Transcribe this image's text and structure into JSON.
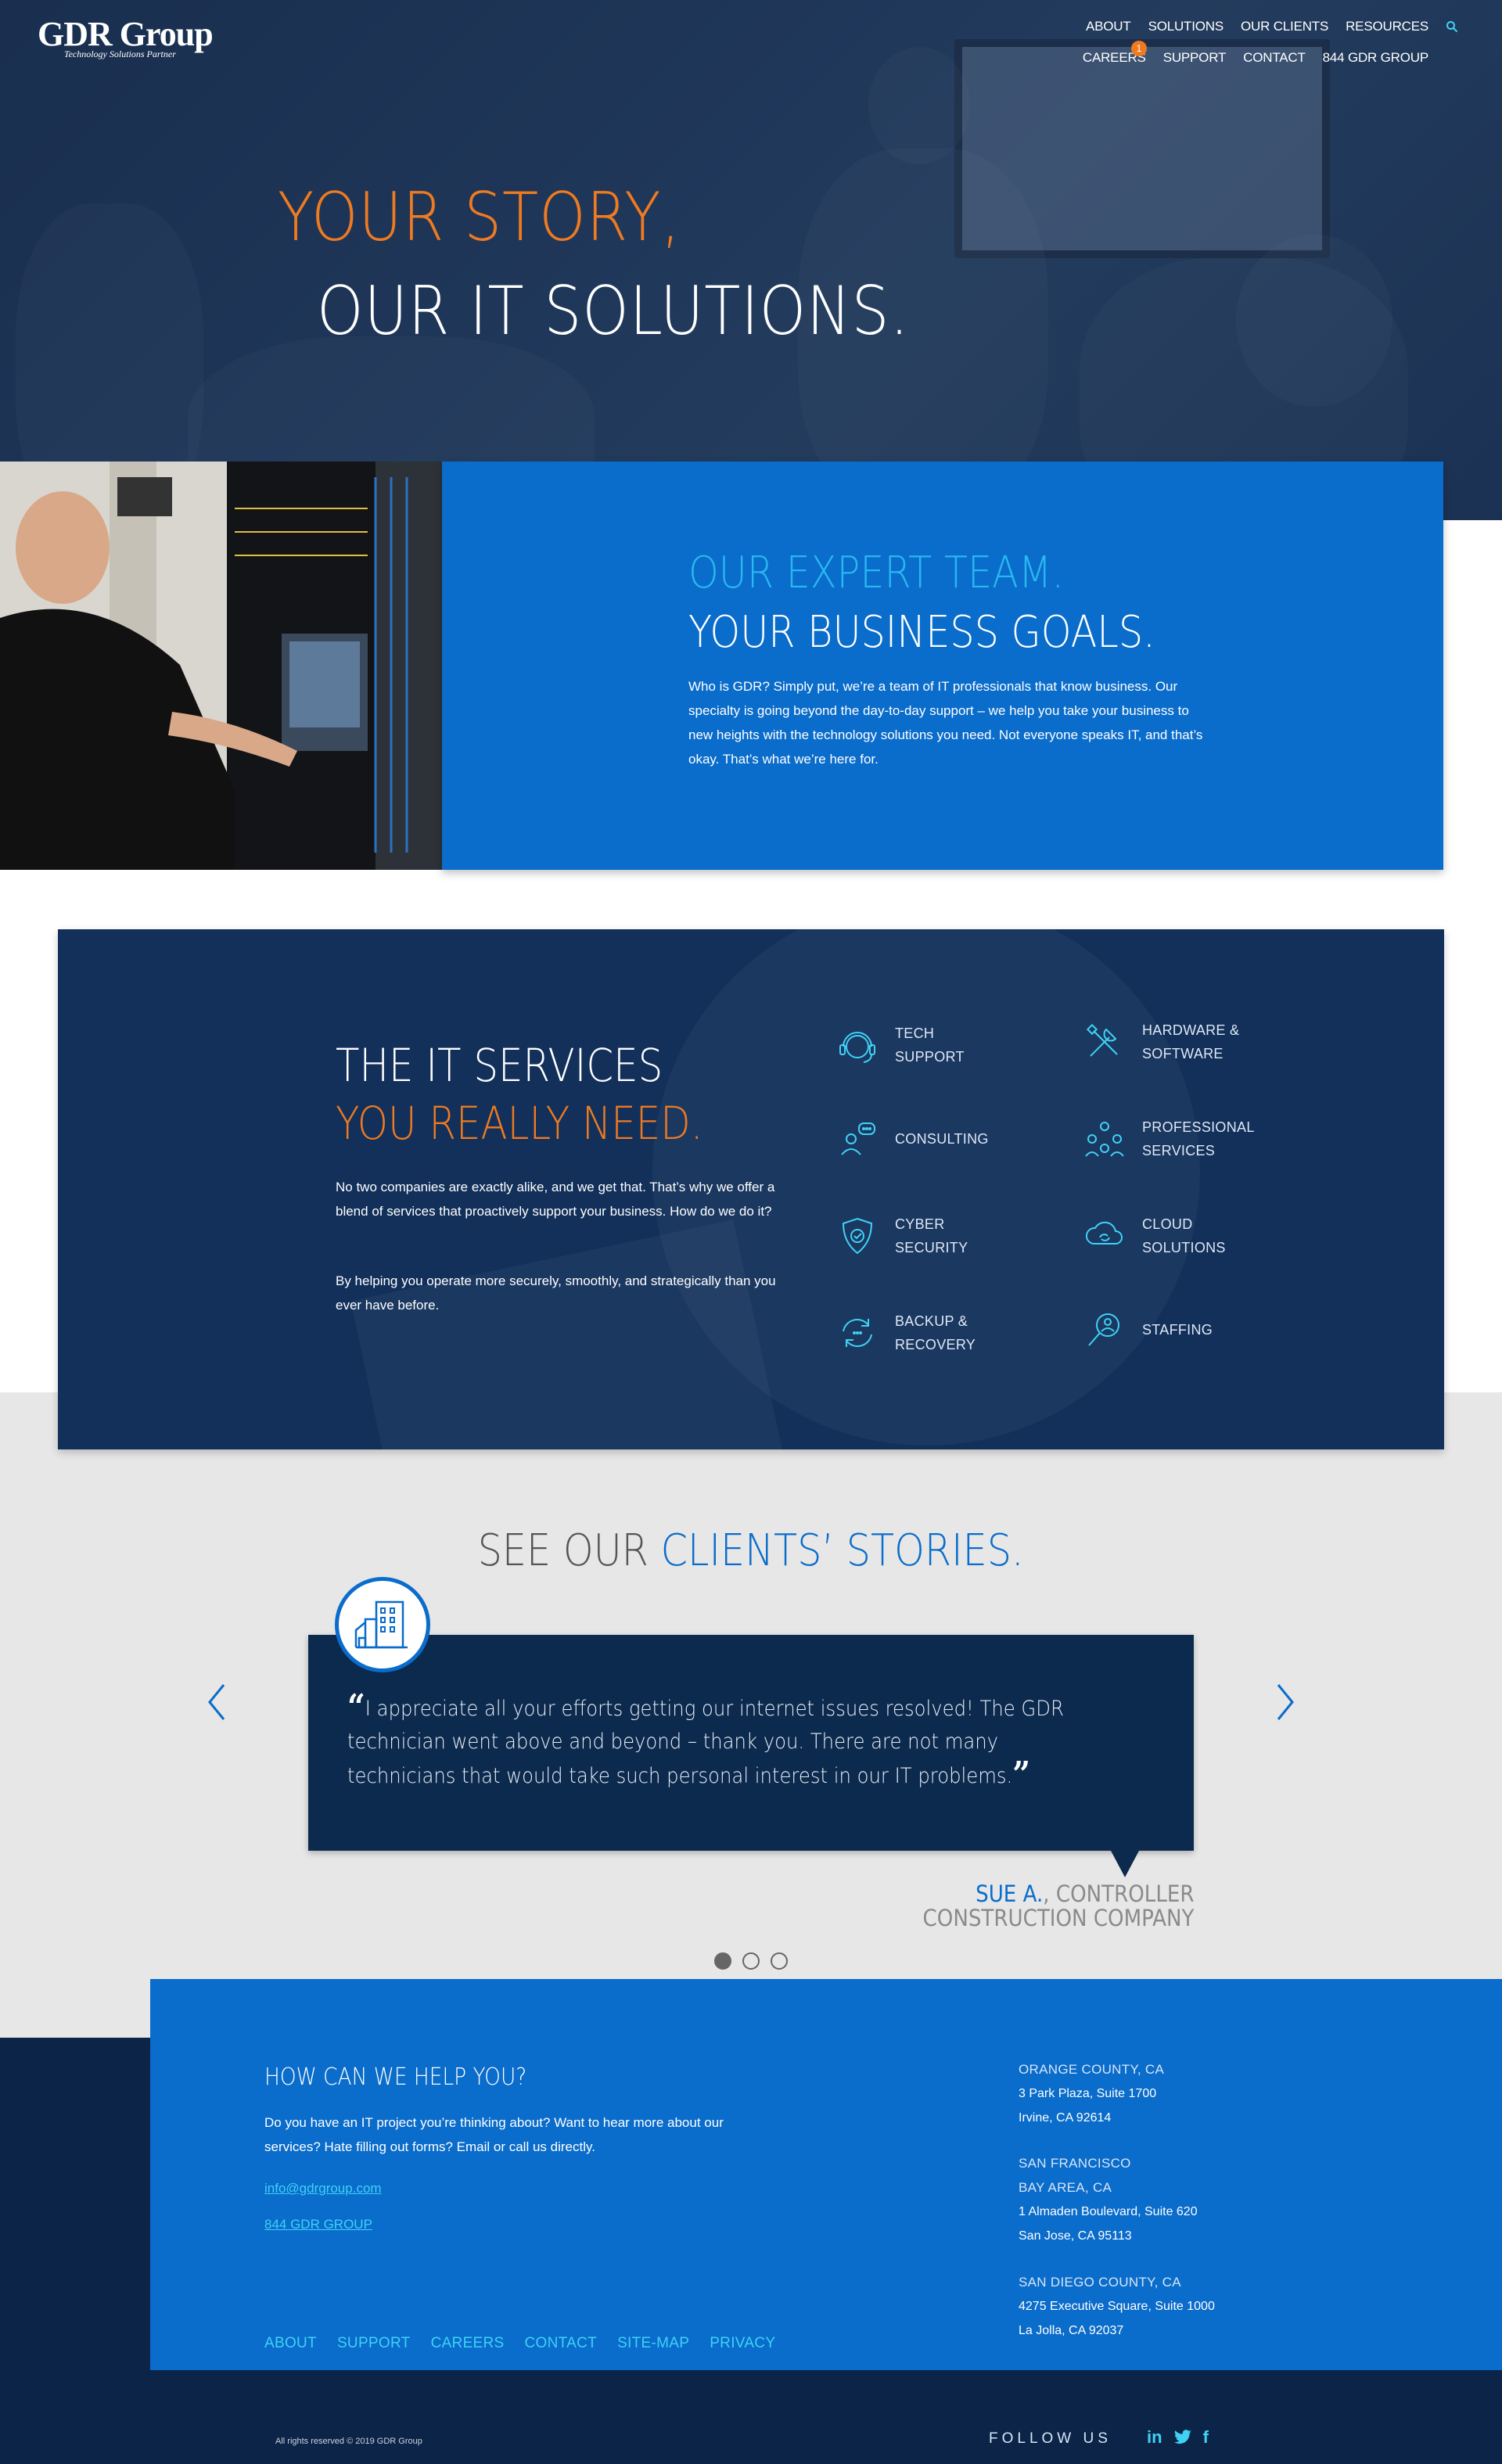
{
  "brand": {
    "name": "GDR Group",
    "tagline": "Technology Solutions Partner"
  },
  "nav": {
    "row1": [
      "ABOUT",
      "SOLUTIONS",
      "OUR CLIENTS",
      "RESOURCES"
    ],
    "row2": [
      "CAREERS",
      "SUPPORT",
      "CONTACT",
      "844 GDR GROUP"
    ],
    "careers_badge": "1"
  },
  "hero": {
    "line1": "YOUR STORY,",
    "line2": "OUR IT SOLUTIONS."
  },
  "team": {
    "heading1": "OUR EXPERT TEAM.",
    "heading2": "YOUR BUSINESS GOALS.",
    "body": "Who is GDR? Simply put, we’re a team of IT professionals that know business. Our specialty is going beyond the day-to-day support – we help you take your business to new heights with the technology solutions you need. Not everyone speaks IT, and that’s okay. That’s what we’re here for."
  },
  "services": {
    "heading1": "THE IT SERVICES",
    "heading2": "YOU REALLY NEED.",
    "para1": "No two companies are exactly alike, and we get that. That’s why we offer a blend of services that proactively support your business. How do we do it?",
    "para2": "By helping you operate more securely, smoothly, and strategically than you ever have before.",
    "items": [
      {
        "label": "TECH\nSUPPORT",
        "icon": "headset-icon"
      },
      {
        "label": "HARDWARE &\nSOFTWARE",
        "icon": "tools-icon"
      },
      {
        "label": "CONSULTING",
        "icon": "consulting-icon"
      },
      {
        "label": "PROFESSIONAL\nSERVICES",
        "icon": "team-icon"
      },
      {
        "label": "CYBER\nSECURITY",
        "icon": "shield-icon"
      },
      {
        "label": "CLOUD\nSOLUTIONS",
        "icon": "cloud-icon"
      },
      {
        "label": "BACKUP &\nRECOVERY",
        "icon": "backup-icon"
      },
      {
        "label": "STAFFING",
        "icon": "staffing-icon"
      }
    ]
  },
  "clients": {
    "title_prefix": "SEE OUR ",
    "title_highlight": "CLIENTS’ STORIES.",
    "quote": "I appreciate all your efforts getting our internet issues resolved! The GDR technician went above and beyond – thank you. There are not many technicians that would take such personal interest in our IT problems.",
    "author_name": "SUE A.",
    "author_role": ", CONTROLLER",
    "author_company": "CONSTRUCTION COMPANY"
  },
  "contact": {
    "title": "HOW CAN WE HELP YOU?",
    "body": "Do you have an IT project you’re thinking about? Want to hear more about our services? Hate filling out forms? Email or call us directly.",
    "email": "info@gdrgroup.com",
    "phone": "844 GDR GROUP",
    "links": [
      "ABOUT",
      "SUPPORT",
      "CAREERS",
      "CONTACT",
      "SITE-MAP",
      "PRIVACY"
    ],
    "offices": [
      {
        "head": "ORANGE COUNTY, CA",
        "lines": [
          "3 Park Plaza, Suite 1700",
          "Irvine, CA 92614"
        ]
      },
      {
        "head": "SAN FRANCISCO\nBAY AREA, CA",
        "lines": [
          "1 Almaden Boulevard, Suite 620",
          "San Jose, CA 95113"
        ]
      },
      {
        "head": "SAN DIEGO COUNTY, CA",
        "lines": [
          "4275 Executive Square, Suite 1000",
          "La Jolla, CA 92037"
        ]
      }
    ]
  },
  "footer": {
    "copyright": "All rights reserved © 2019 GDR Group",
    "follow": "FOLLOW US",
    "social": [
      "in",
      "twitter",
      "f"
    ]
  },
  "colors": {
    "orange": "#ee7a21",
    "blue": "#0a6ccb",
    "navy": "#0b2447",
    "cyan": "#3fd2f5"
  }
}
